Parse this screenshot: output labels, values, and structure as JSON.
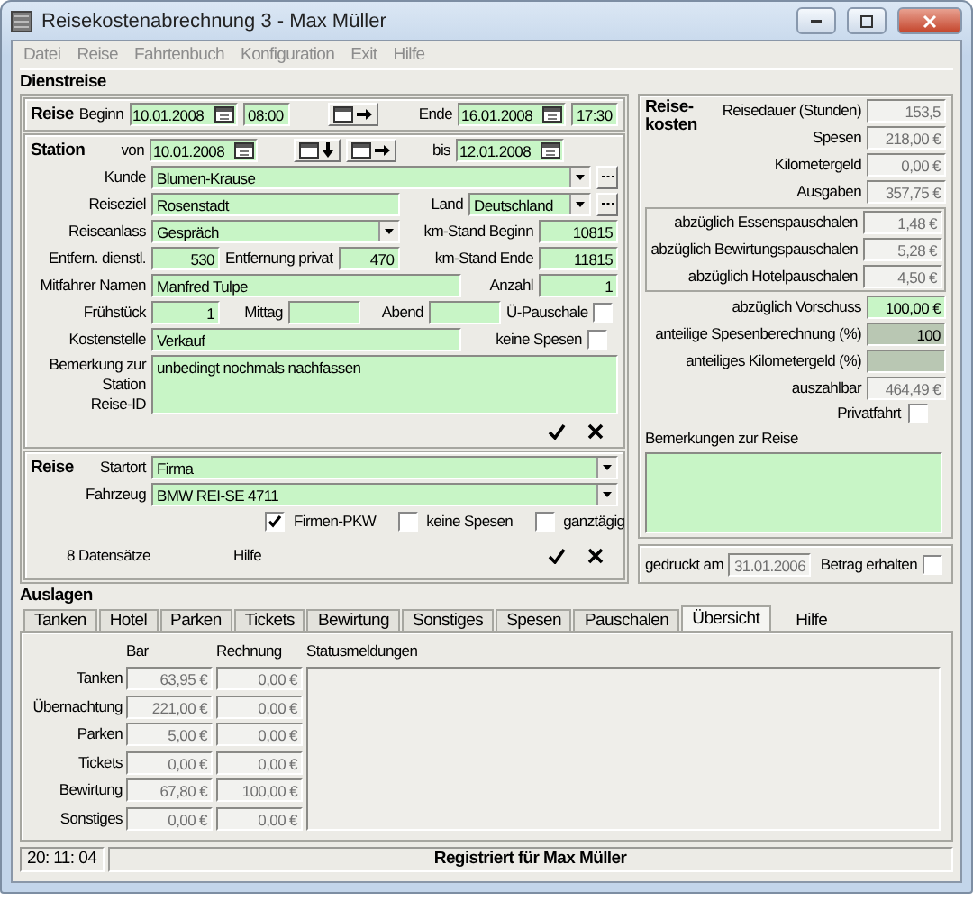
{
  "window": {
    "title": "Reisekostenabrechnung 3 - Max Müller"
  },
  "menu": [
    {
      "label": "Datei",
      "disabled": true
    },
    {
      "label": "Reise",
      "disabled": true
    },
    {
      "label": "Fahrtenbuch",
      "disabled": true
    },
    {
      "label": "Konfiguration",
      "disabled": true
    },
    {
      "label": "Exit",
      "disabled": true
    },
    {
      "label": "Hilfe",
      "disabled": true
    }
  ],
  "business_trip": {
    "heading": "Dienstreise",
    "trip": {
      "label": "Reise",
      "begin_label": "Beginn",
      "begin_date": "10.01.2008",
      "begin_time": "08:00",
      "end_label": "Ende",
      "end_date": "16.01.2008",
      "end_time": "17:30"
    },
    "station": {
      "label": "Station",
      "from_label": "von",
      "from_date": "10.01.2008",
      "to_label": "bis",
      "to_date": "12.01.2008"
    },
    "customer": {
      "label": "Kunde",
      "value": "Blumen-Krause"
    },
    "destination": {
      "label": "Reiseziel",
      "value": "Rosenstadt"
    },
    "country": {
      "label": "Land",
      "value": "Deutschland"
    },
    "purpose": {
      "label": "Reiseanlass",
      "value": "Gespräch"
    },
    "km_start": {
      "label": "km-Stand Beginn",
      "value": "10815"
    },
    "distance_business": {
      "label": "Entfern. dienstl.",
      "value": "530"
    },
    "distance_private": {
      "label": "Entfernung privat",
      "value": "470"
    },
    "km_end": {
      "label": "km-Stand Ende",
      "value": "11815"
    },
    "passengers": {
      "label": "Mitfahrer Namen",
      "value": "Manfred Tulpe"
    },
    "passenger_count": {
      "label": "Anzahl",
      "value": "1"
    },
    "breakfast": {
      "label": "Frühstück",
      "value": "1"
    },
    "lunch": {
      "label": "Mittag"
    },
    "dinner": {
      "label": "Abend"
    },
    "overnight_flat": {
      "label": "Ü-Pauschale",
      "checked": false
    },
    "cost_center": {
      "label": "Kostenstelle",
      "value": "Verkauf"
    },
    "station_no_expenses": {
      "label": "keine Spesen",
      "checked": false
    },
    "remark": {
      "label": "Bemerkung zur Station",
      "value": "unbedingt nochmals nachfassen"
    },
    "trip_id": {
      "label": "Reise-ID"
    }
  },
  "journey": {
    "label": "Reise",
    "start_label": "Startort",
    "start": "Firma",
    "vehicle_label": "Fahrzeug",
    "vehicle": "BMW REI-SE 4711",
    "options": [
      {
        "label": "Firmen-PKW",
        "checked": true
      },
      {
        "label": "keine Spesen",
        "checked": false
      },
      {
        "label": "ganztägig",
        "checked": false
      }
    ],
    "records": "8 Datensätze",
    "help": "Hilfe"
  },
  "costs": {
    "heading": "Reise-kosten",
    "groups": [
      {
        "rows": [
          {
            "label": "Reisedauer (Stunden)",
            "value": "153,5",
            "kind": "readonly"
          },
          {
            "label": "Spesen",
            "value": "218,00 €",
            "kind": "readonly"
          },
          {
            "label": "Kilometergeld",
            "value": "0,00 €",
            "kind": "readonly"
          },
          {
            "label": "Ausgaben",
            "value": "357,75 €",
            "kind": "readonly"
          }
        ]
      },
      {
        "rows": [
          {
            "label": "abzüglich Essenspauschalen",
            "value": "1,48 €",
            "kind": "readonly"
          },
          {
            "label": "abzüglich Bewirtungspauschalen",
            "value": "5,28 €",
            "kind": "readonly"
          },
          {
            "label": "abzüglich Hotelpauschalen",
            "value": "4,50 €",
            "kind": "readonly"
          }
        ]
      },
      {
        "rows": [
          {
            "label": "abzüglich Vorschuss",
            "value": "100,00 €",
            "kind": "input"
          },
          {
            "label": "anteilige Spesenberechnung (%)",
            "value": "100",
            "kind": "locked"
          },
          {
            "label": "anteiliges Kilometergeld (%)",
            "kind": "locked"
          },
          {
            "label": "auszahlbar",
            "value": "464,49 €",
            "kind": "readonly"
          }
        ]
      }
    ],
    "private_trip": {
      "label": "Privatfahrt",
      "checked": false
    },
    "remarks": {
      "label": "Bemerkungen zur Reise"
    },
    "printed": {
      "label": "gedruckt am",
      "value": "31.01.2006"
    },
    "amount_received": {
      "label": "Betrag erhalten",
      "checked": false
    }
  },
  "expenses": {
    "heading": "Auslagen",
    "tabs": [
      {
        "label": "Tanken",
        "selected": false
      },
      {
        "label": "Hotel",
        "selected": false
      },
      {
        "label": "Parken",
        "selected": false
      },
      {
        "label": "Tickets",
        "selected": false
      },
      {
        "label": "Bewirtung",
        "selected": false
      },
      {
        "label": "Sonstiges",
        "selected": false
      },
      {
        "label": "Spesen",
        "selected": false
      },
      {
        "label": "Pauschalen",
        "selected": false
      },
      {
        "label": "Übersicht",
        "selected": true
      }
    ],
    "help": "Hilfe",
    "columns": [
      "Bar",
      "Rechnung",
      "Statusmeldungen"
    ],
    "rows": [
      {
        "label": "Tanken",
        "cash": "63,95 €",
        "invoice": "0,00 €"
      },
      {
        "label": "Übernachtung",
        "cash": "221,00 €",
        "invoice": "0,00 €"
      },
      {
        "label": "Parken",
        "cash": "5,00 €",
        "invoice": "0,00 €"
      },
      {
        "label": "Tickets",
        "cash": "0,00 €",
        "invoice": "0,00 €"
      },
      {
        "label": "Bewirtung",
        "cash": "67,80 €",
        "invoice": "100,00 €"
      },
      {
        "label": "Sonstiges",
        "cash": "0,00 €",
        "invoice": "0,00 €"
      }
    ]
  },
  "status_bar": {
    "time": "20: 11: 04",
    "message": "Registriert für Max Müller"
  }
}
